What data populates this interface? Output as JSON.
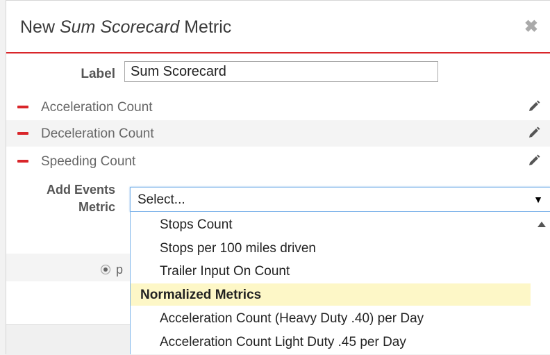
{
  "dialog": {
    "title_prefix": "New ",
    "title_italic": "Sum Scorecard",
    "title_suffix": " Metric",
    "close_symbol": "✖"
  },
  "form": {
    "label_text": "Label",
    "label_value": "Sum Scorecard",
    "metrics": [
      {
        "name": "Acceleration Count"
      },
      {
        "name": "Deceleration Count"
      },
      {
        "name": "Speeding Count"
      }
    ],
    "add_events_label_line1": "Add Events",
    "add_events_label_line2": "Metric",
    "radio_label": "p"
  },
  "select": {
    "value": "Select...",
    "arrow": "▼",
    "options": [
      {
        "label": "Stops Count",
        "type": "option"
      },
      {
        "label": "Stops per 100 miles driven",
        "type": "option"
      },
      {
        "label": "Trailer Input On Count",
        "type": "option"
      },
      {
        "label": "Normalized Metrics",
        "type": "group"
      },
      {
        "label": "Acceleration Count (Heavy Duty .40) per Day",
        "type": "option"
      },
      {
        "label": "Acceleration Count Light Duty .45 per Day",
        "type": "option"
      }
    ]
  },
  "colors": {
    "accent_red": "#d9262a",
    "focus_blue": "#7eb4ea",
    "group_highlight": "#fdf7c7"
  },
  "icons": {
    "remove": "minus-icon",
    "edit": "pencil-icon",
    "close": "close-icon",
    "scroll": "scroll-up-icon"
  }
}
